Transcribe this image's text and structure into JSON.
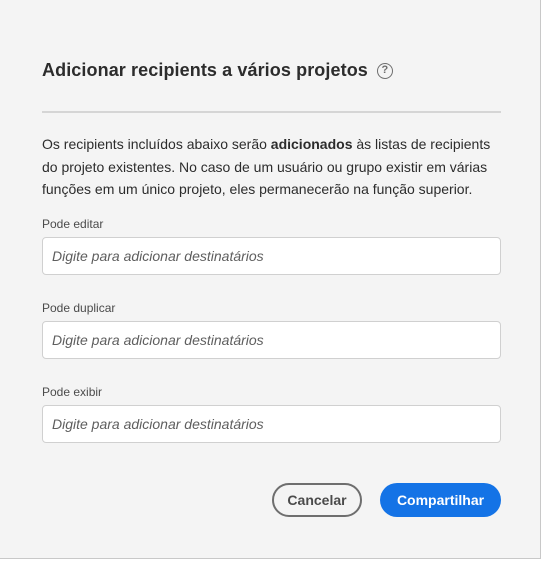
{
  "dialog": {
    "title": "Adicionar recipients a vários projetos",
    "help_icon_label": "?",
    "description": {
      "part1": "Os recipients incluídos abaixo serão ",
      "bold": "adicionados",
      "part2": " às listas de recipients do projeto existentes. No caso de um usuário ou grupo existir em várias funções em um único projeto, eles permanecerão na função superior."
    },
    "fields": [
      {
        "label": "Pode editar",
        "placeholder": "Digite para adicionar destinatários",
        "value": ""
      },
      {
        "label": "Pode duplicar",
        "placeholder": "Digite para adicionar destinatários",
        "value": ""
      },
      {
        "label": "Pode exibir",
        "placeholder": "Digite para adicionar destinatários",
        "value": ""
      }
    ],
    "buttons": {
      "cancel_label": "Cancelar",
      "share_label": "Compartilhar"
    }
  },
  "colors": {
    "primary_button": "#1473e6",
    "dialog_background": "#f4f4f4",
    "text": "#2c2c2c"
  },
  "icons": {
    "help": "help-circle-icon"
  }
}
